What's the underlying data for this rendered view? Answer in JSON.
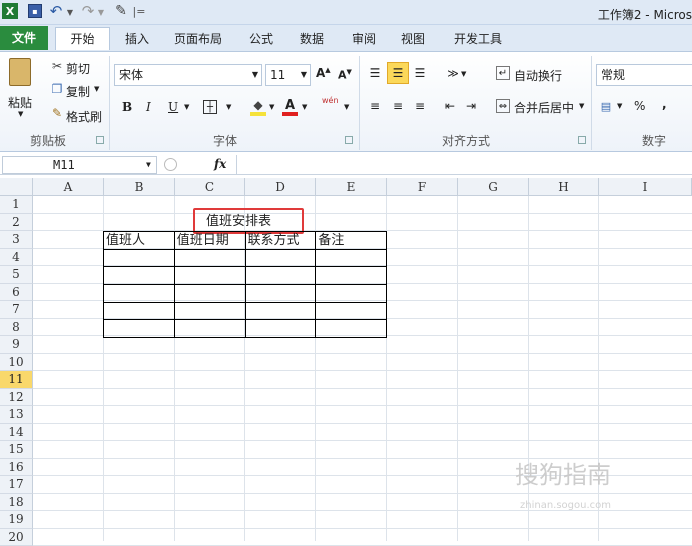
{
  "window": {
    "title": "工作簿2 - Micros"
  },
  "tabs": [
    "文件",
    "开始",
    "插入",
    "页面布局",
    "公式",
    "数据",
    "审阅",
    "视图",
    "开发工具"
  ],
  "clipboard": {
    "paste": "粘贴",
    "cut": "剪切",
    "copy": "复制",
    "format_painter": "格式刷",
    "label": "剪贴板"
  },
  "font": {
    "name": "宋体",
    "size": "11",
    "bold": "B",
    "italic": "I",
    "underline": "U",
    "label": "字体",
    "pinyin": "wén"
  },
  "alignment": {
    "wrap": "自动换行",
    "merge": "合并后居中",
    "label": "对齐方式"
  },
  "number": {
    "format": "常规",
    "percent": "%",
    "comma": ",",
    "label": "数字"
  },
  "formula_bar": {
    "name_box": "M11",
    "fx": "fx",
    "formula": ""
  },
  "columns": [
    "A",
    "B",
    "C",
    "D",
    "E",
    "F",
    "G",
    "H",
    "I"
  ],
  "rows": [
    "1",
    "2",
    "3",
    "4",
    "5",
    "6",
    "7",
    "8",
    "9",
    "10",
    "11",
    "12",
    "13",
    "14",
    "15",
    "16",
    "17",
    "18",
    "19",
    "20"
  ],
  "selected_row": "11",
  "sheet": {
    "title": "值班安排表",
    "headers": [
      "值班人",
      "值班日期",
      "联系方式",
      "备注"
    ]
  },
  "watermark": {
    "text": "搜狗指南",
    "sub": "zhinan.sogou.com"
  },
  "colors": {
    "file_tab": "#2a8c3e",
    "highlight": "#e03a3a",
    "selected_row": "#f9d86b"
  }
}
